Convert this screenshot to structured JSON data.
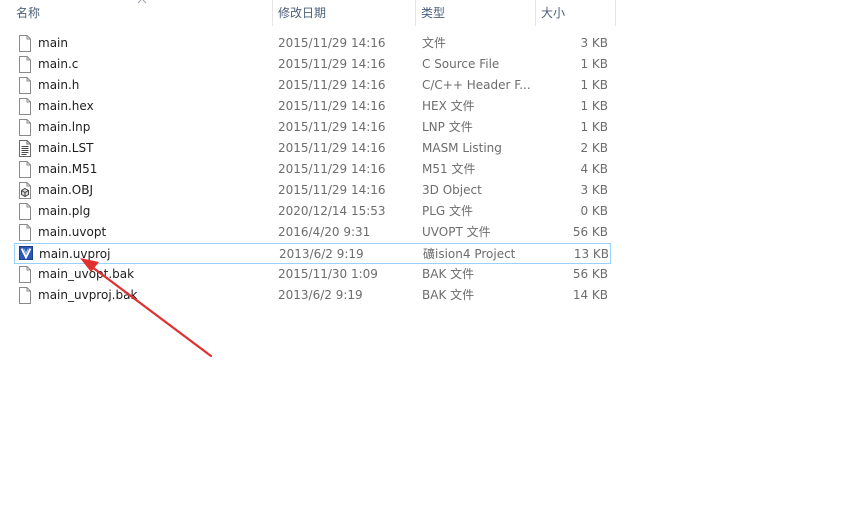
{
  "columns": {
    "name": "名称",
    "date": "修改日期",
    "type": "类型",
    "size": "大小"
  },
  "files": [
    {
      "name": "main",
      "date": "2015/11/29 14:16",
      "type": "文件",
      "size": "3 KB",
      "icon": "blank-file-icon"
    },
    {
      "name": "main.c",
      "date": "2015/11/29 14:16",
      "type": "C Source File",
      "size": "1 KB",
      "icon": "blank-file-icon"
    },
    {
      "name": "main.h",
      "date": "2015/11/29 14:16",
      "type": "C/C++ Header F...",
      "size": "1 KB",
      "icon": "blank-file-icon"
    },
    {
      "name": "main.hex",
      "date": "2015/11/29 14:16",
      "type": "HEX 文件",
      "size": "1 KB",
      "icon": "blank-file-icon"
    },
    {
      "name": "main.lnp",
      "date": "2015/11/29 14:16",
      "type": "LNP 文件",
      "size": "1 KB",
      "icon": "blank-file-icon"
    },
    {
      "name": "main.LST",
      "date": "2015/11/29 14:16",
      "type": "MASM Listing",
      "size": "2 KB",
      "icon": "text-file-icon"
    },
    {
      "name": "main.M51",
      "date": "2015/11/29 14:16",
      "type": "M51 文件",
      "size": "4 KB",
      "icon": "blank-file-icon"
    },
    {
      "name": "main.OBJ",
      "date": "2015/11/29 14:16",
      "type": "3D Object",
      "size": "3 KB",
      "icon": "3d-object-file-icon"
    },
    {
      "name": "main.plg",
      "date": "2020/12/14 15:53",
      "type": "PLG 文件",
      "size": "0 KB",
      "icon": "blank-file-icon"
    },
    {
      "name": "main.uvopt",
      "date": "2016/4/20 9:31",
      "type": "UVOPT 文件",
      "size": "56 KB",
      "icon": "blank-file-icon"
    },
    {
      "name": "main.uvproj",
      "date": "2013/6/2 9:19",
      "type": "礦ision4 Project",
      "size": "13 KB",
      "icon": "keil-project-icon",
      "selected": true
    },
    {
      "name": "main_uvopt.bak",
      "date": "2015/11/30 1:09",
      "type": "BAK 文件",
      "size": "56 KB",
      "icon": "blank-file-icon"
    },
    {
      "name": "main_uvproj.bak",
      "date": "2013/6/2 9:19",
      "type": "BAK 文件",
      "size": "14 KB",
      "icon": "blank-file-icon"
    }
  ],
  "colors": {
    "header_text": "#4c607a",
    "selection_border": "#99d1ff",
    "annotation_arrow": "#e03030"
  }
}
